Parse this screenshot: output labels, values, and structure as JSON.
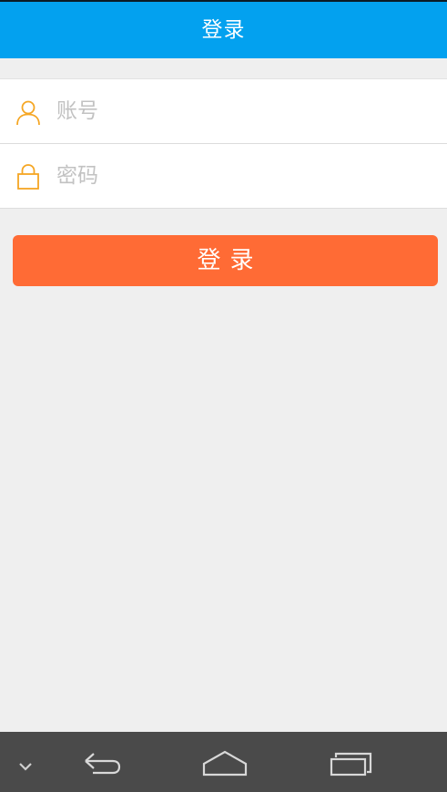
{
  "header": {
    "title": "登录"
  },
  "form": {
    "account": {
      "icon": "user-icon",
      "placeholder": "账号",
      "value": ""
    },
    "password": {
      "icon": "lock-icon",
      "placeholder": "密码",
      "value": ""
    }
  },
  "login_button": {
    "label": "登录"
  },
  "navbar": {
    "items": [
      {
        "icon": "chevron-down-icon"
      },
      {
        "icon": "back-icon"
      },
      {
        "icon": "home-icon"
      },
      {
        "icon": "recents-icon"
      }
    ]
  },
  "colors": {
    "header_bg": "#03a1ef",
    "accent_icon": "#f5a623",
    "button_bg": "#ff6b35",
    "background": "#efefef",
    "navbar_bg": "#4a4a4a"
  }
}
